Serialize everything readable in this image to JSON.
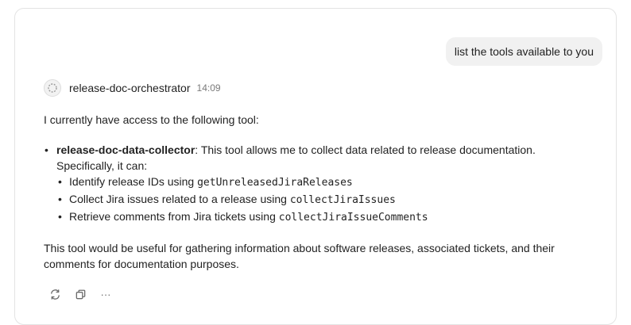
{
  "user_message": "list the tools available to you",
  "agent": {
    "name": "release-doc-orchestrator",
    "time": "14:09"
  },
  "response": {
    "intro": "I currently have access to the following tool:",
    "tool": {
      "name": "release-doc-data-collector",
      "description": ": This tool allows me to collect data related to release documentation. Specifically, it can:",
      "capabilities": [
        {
          "text": "Identify release IDs using ",
          "code": "getUnreleasedJiraReleases"
        },
        {
          "text": "Collect Jira issues related to a release using ",
          "code": "collectJiraIssues"
        },
        {
          "text": "Retrieve comments from Jira tickets using ",
          "code": "collectJiraIssueComments"
        }
      ]
    },
    "summary": "This tool would be useful for gathering information about software releases, associated tickets, and their comments for documentation purposes."
  },
  "actions": {
    "retry_icon": "refresh-icon",
    "copy_icon": "copy-icon",
    "more_icon": "more-icon",
    "more_label": "···"
  }
}
